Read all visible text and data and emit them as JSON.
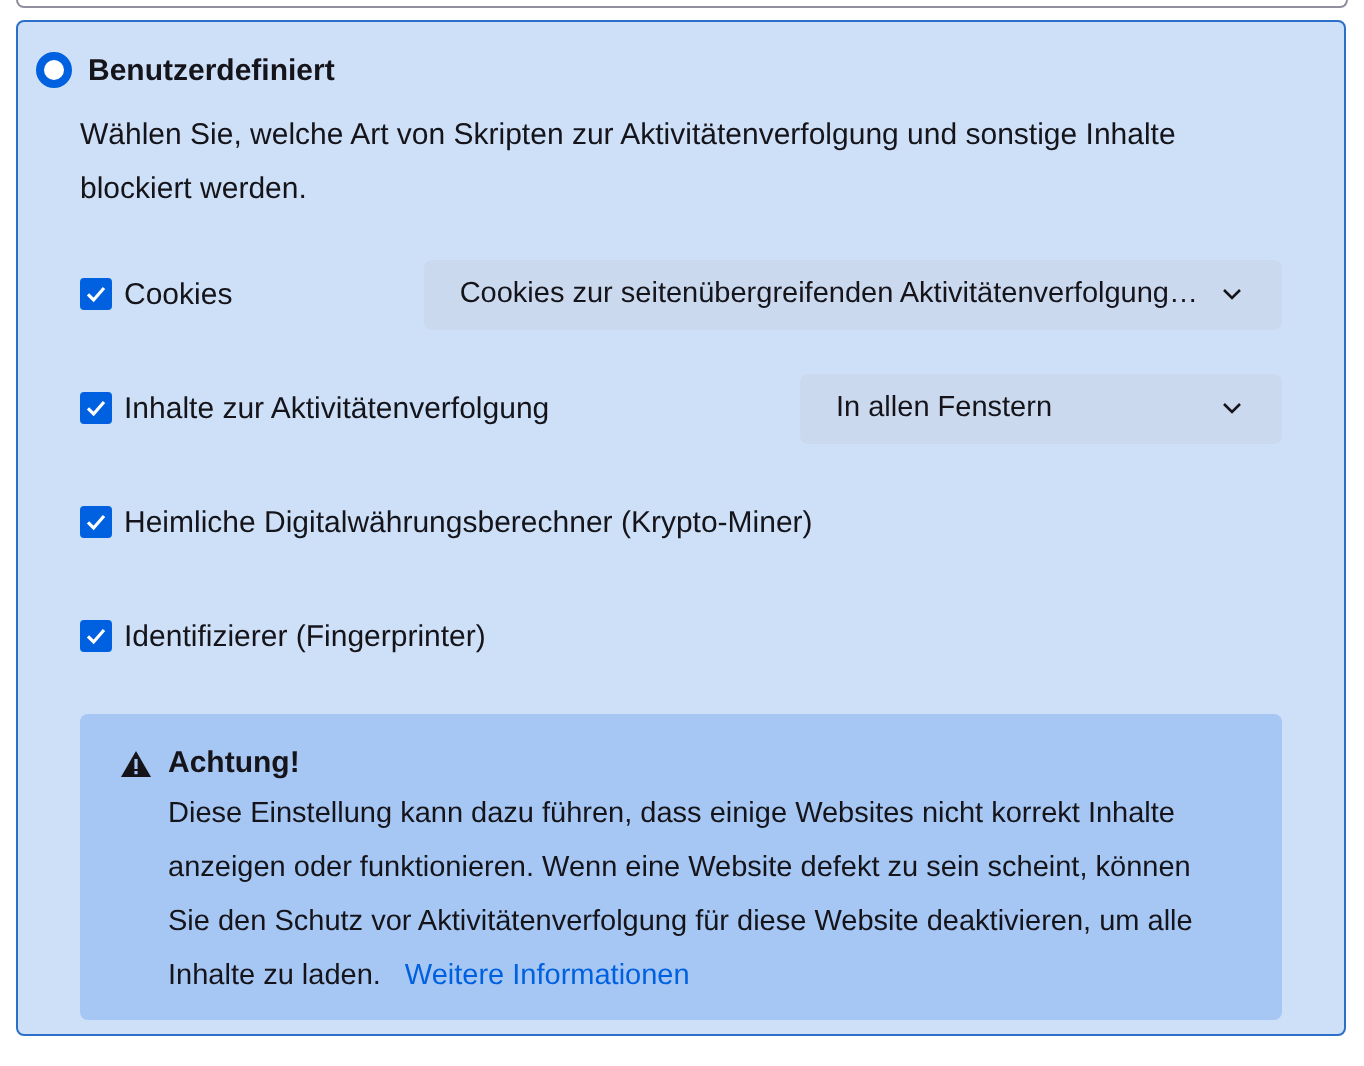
{
  "option": {
    "label": "Benutzerdefiniert",
    "selected": true,
    "description": "Wählen Sie, welche Art von Skripten zur Aktivitätenverfolgung und sonstige Inhalte blockiert werden."
  },
  "settings": [
    {
      "label": "Cookies",
      "checked": true,
      "dropdown": "Cookies zur seitenübergreifenden Aktivitätenverfolgung…"
    },
    {
      "label": "Inhalte zur Aktivitätenverfolgung",
      "checked": true,
      "dropdown": "In allen Fenstern"
    },
    {
      "label": "Heimliche Digitalwährungsberechner (Krypto-Miner)",
      "checked": true
    },
    {
      "label": "Identifizierer (Fingerprinter)",
      "checked": true
    }
  ],
  "warning": {
    "title": "Achtung!",
    "text": "Diese Einstellung kann dazu führen, dass einige Websites nicht korrekt Inhalte anzeigen oder funktionieren. Wenn eine Website defekt zu sein scheint, können Sie den Schutz vor Aktivitätenverfolgung für diese Website deaktivieren, um alle Inhalte zu laden.",
    "link": "Weitere Informationen"
  }
}
